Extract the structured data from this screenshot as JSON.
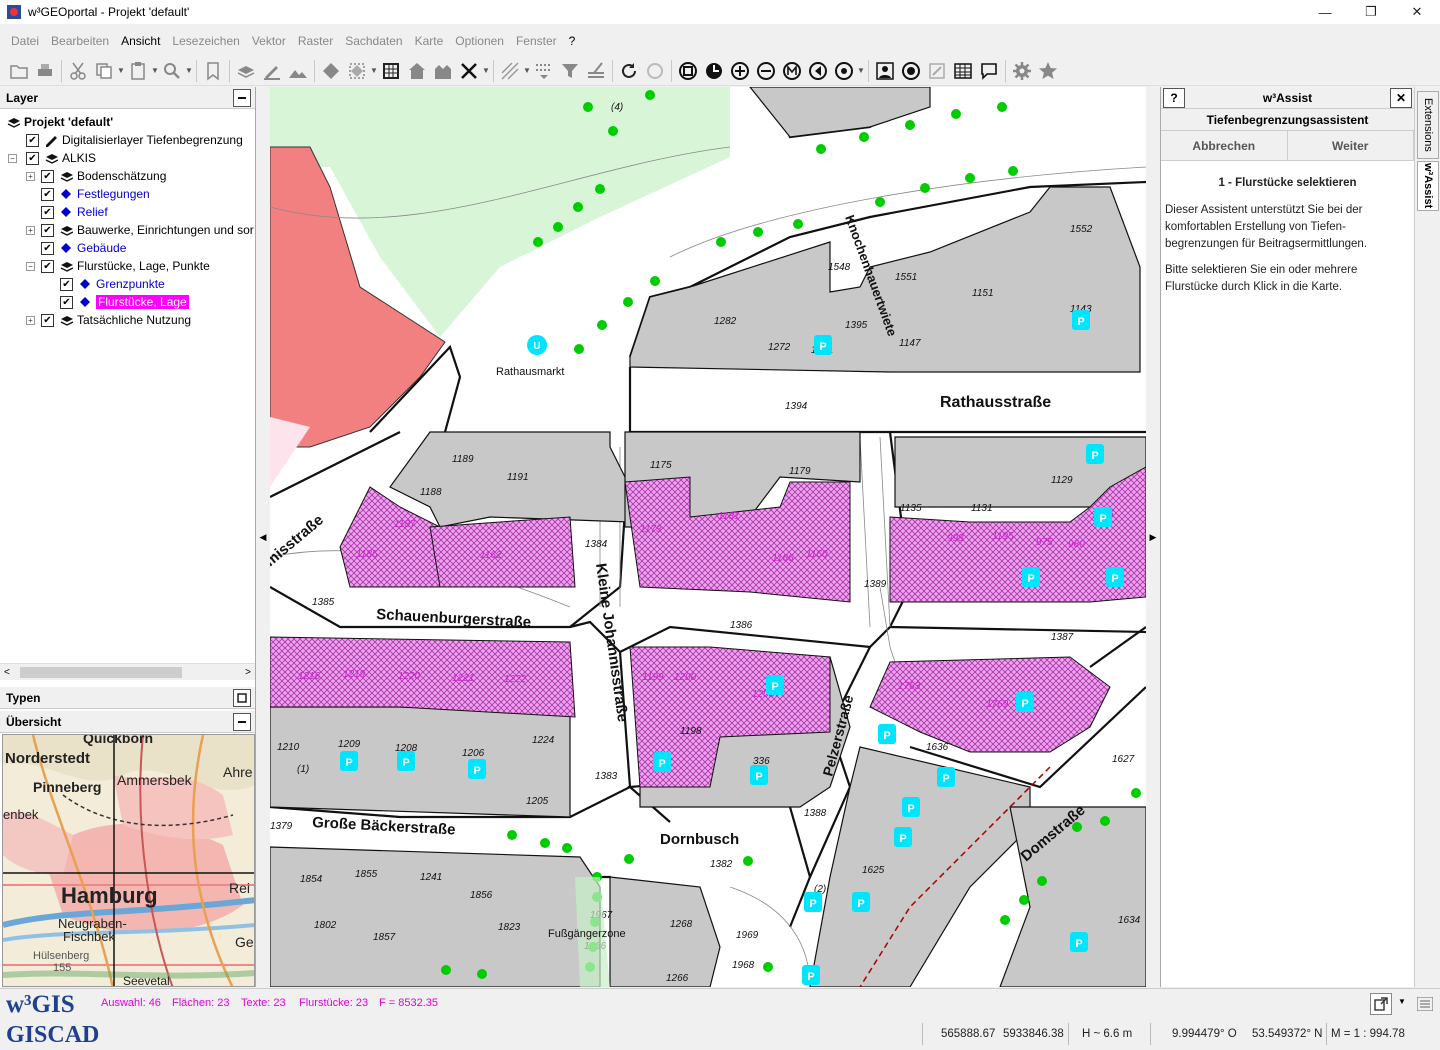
{
  "window": {
    "title": "w³GEOportal - Projekt 'default'",
    "minimize": "—",
    "maximize": "❐",
    "close": "✕"
  },
  "menu": [
    "Datei",
    "Bearbeiten",
    "Ansicht",
    "Lesezeichen",
    "Vektor",
    "Raster",
    "Sachdaten",
    "Karte",
    "Optionen",
    "Fenster",
    "?"
  ],
  "menu_active": "Ansicht",
  "layer_panel": {
    "title": "Layer",
    "tree": [
      {
        "label": "Projekt 'default'",
        "bold": true
      },
      {
        "label": "Digitalisierlayer Tiefenbegrenzung"
      },
      {
        "label": "ALKIS"
      },
      {
        "label": "Bodenschätzung"
      },
      {
        "label": "Festlegungen"
      },
      {
        "label": "Relief"
      },
      {
        "label": "Bauwerke, Einrichtungen und sor"
      },
      {
        "label": "Gebäude"
      },
      {
        "label": "Flurstücke, Lage, Punkte"
      },
      {
        "label": "Grenzpunkte"
      },
      {
        "label": "Flurstücke, Lage"
      },
      {
        "label": "Tatsächliche Nutzung"
      }
    ]
  },
  "types_panel": {
    "title": "Typen"
  },
  "overview_panel": {
    "title": "Übersicht",
    "labels": [
      "Quickborn",
      "Norderstedt",
      "Ammersbek",
      "Ahre",
      "Pinneberg",
      "enbek",
      "Hamburg",
      "Rei",
      "Neugraben-",
      "Fischbek",
      "Ge",
      "Hülsenberg",
      "155",
      "Seevetal"
    ]
  },
  "map": {
    "street_labels": [
      "Rathausstraße",
      "Schauenburgerstraße",
      "Kleine Johannisstraße",
      "Pelzerstraße",
      "Große Bäckerstraße",
      "Domstraße",
      "Knochenhauertwiete",
      "Dornbusch",
      "Rathausmarkt",
      "misstraße",
      "Fußgängerzone"
    ],
    "parcel_labels": [
      "1552",
      "1548",
      "1551",
      "1151",
      "1143",
      "1282",
      "1272",
      "1271",
      "1395",
      "1147",
      "1394",
      "1189",
      "1191",
      "1175",
      "1179",
      "1129",
      "1188",
      "1135",
      "1131",
      "1187",
      "1186",
      "1162",
      "1384",
      "1173",
      "1181",
      "1166",
      "1160",
      "998",
      "1195",
      "975",
      "980",
      "1126",
      "1389",
      "1385",
      "1386",
      "1387",
      "1216",
      "1219",
      "1220",
      "1221",
      "1222",
      "1199",
      "1200",
      "1203",
      "1763",
      "1769",
      "1210",
      "1209",
      "1208",
      "1206",
      "1224",
      "1198",
      "336",
      "1636",
      "1627",
      "1205",
      "1383",
      "1388",
      "1379",
      "1382",
      "1625",
      "1854",
      "1855",
      "1241",
      "1856",
      "1857",
      "1802",
      "1823",
      "1967",
      "1966",
      "1268",
      "1969",
      "1968",
      "1266",
      "1634",
      "(1)",
      "(2)",
      "(4)"
    ]
  },
  "assist": {
    "title": "w³Assist",
    "help": "?",
    "close": "✕",
    "subtitle": "Tiefenbegrenzungsassistent",
    "btn_cancel": "Abbrechen",
    "btn_next": "Weiter",
    "step": "1 - Flurstücke selektieren",
    "para1": "Dieser Assistent unterstützt Sie bei der komfortablen Erstellung von Tiefen-begrenzungen für Beitragsermittlungen.",
    "para2": "Bitte selektieren Sie ein oder mehrere Flurstücke durch Klick in die Karte."
  },
  "side_tabs": [
    "Extensions",
    "w³Assist"
  ],
  "status": {
    "logo_top": "w³GIS",
    "logo_bottom": "GISCAD",
    "auswahl": "Auswahl: 46",
    "flaechen": "Flächen: 23",
    "texte": "Texte: 23",
    "flurstuecke": "Flurstücke: 23",
    "f": "F = 8532.35",
    "x": "565888.67",
    "y": "5933846.38",
    "h": "H ~ 6.6  m",
    "lon": "9.994479° O",
    "lat": "53.549372° N",
    "scale": "M = 1 : 994.78"
  },
  "colors": {
    "selected_parcel": "#e8a0e8",
    "selected_hatch": "#cc33cc",
    "building": "#c8c8c8",
    "park": "#d6f5d6",
    "red_building": "#f28080",
    "parking": "#00e5ff",
    "tree": "#00cc00",
    "brand": "#1f3f8f"
  }
}
